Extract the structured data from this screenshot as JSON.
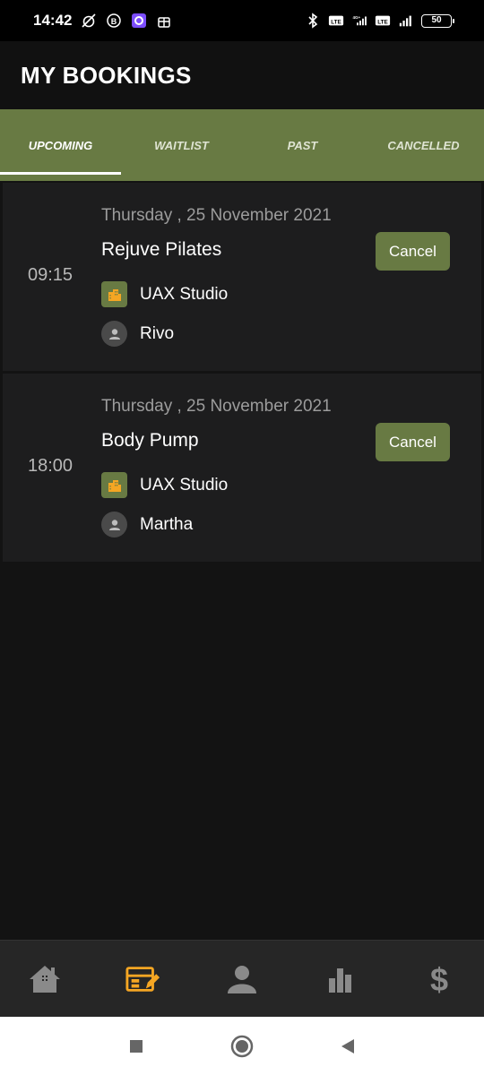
{
  "status_bar": {
    "time": "14:42",
    "left_icons": [
      "alarm-off-icon",
      "b-badge-icon",
      "app-circle-icon",
      "gift-icon"
    ],
    "right_icons": [
      "bluetooth-icon",
      "volte-icon",
      "signal-4g-icon",
      "volte-icon",
      "signal-icon"
    ],
    "net_label": "4G+",
    "volte_label": "Vo LTE",
    "battery": "50"
  },
  "header": {
    "title": "MY BOOKINGS"
  },
  "tabs": [
    {
      "label": "UPCOMING",
      "active": true
    },
    {
      "label": "WAITLIST",
      "active": false
    },
    {
      "label": "PAST",
      "active": false
    },
    {
      "label": "CANCELLED",
      "active": false
    }
  ],
  "bookings": [
    {
      "time": "09:15",
      "date": "Thursday , 25 November 2021",
      "class_name": "Rejuve Pilates",
      "cancel_label": "Cancel",
      "studio": "UAX Studio",
      "instructor": "Rivo"
    },
    {
      "time": "18:00",
      "date": "Thursday , 25 November 2021",
      "class_name": "Body Pump",
      "cancel_label": "Cancel",
      "studio": "UAX Studio",
      "instructor": "Martha"
    }
  ],
  "bottom_nav": [
    {
      "icon": "home-icon",
      "active": false
    },
    {
      "icon": "bookings-icon",
      "active": true
    },
    {
      "icon": "profile-icon",
      "active": false
    },
    {
      "icon": "stats-icon",
      "active": false
    },
    {
      "icon": "dollar-icon",
      "active": false
    }
  ],
  "colors": {
    "accent": "#687a43",
    "active_nav": "#f5a623",
    "inactive_nav": "#8a8a8a",
    "background": "#131313",
    "card": "#1d1d1e"
  }
}
